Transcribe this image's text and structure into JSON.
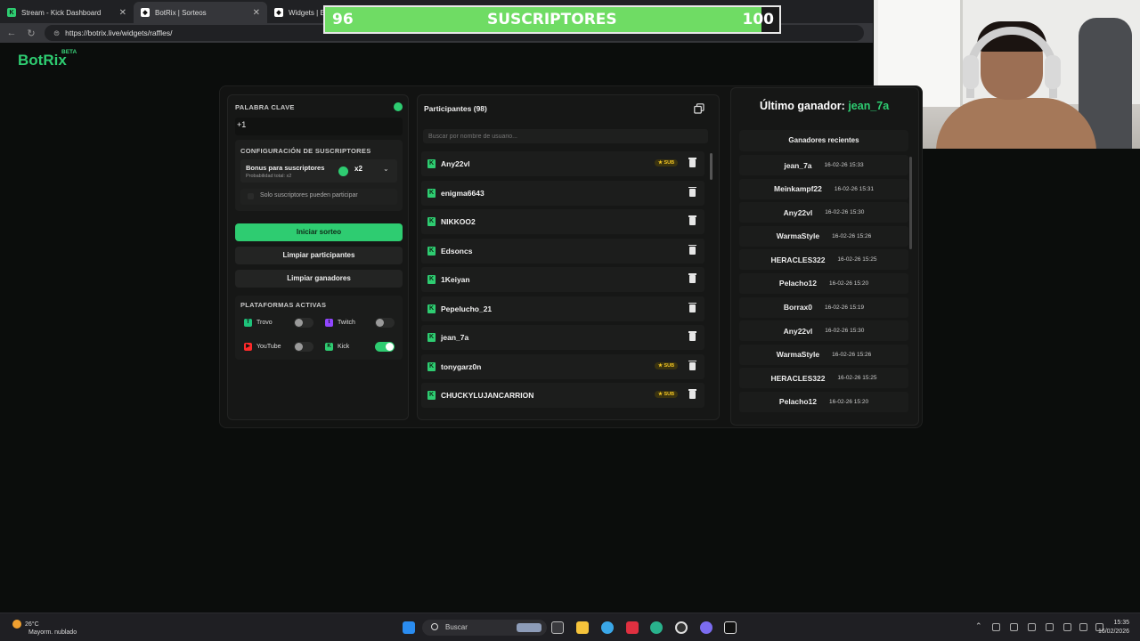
{
  "browser": {
    "tabs": [
      {
        "label": "Stream - Kick Dashboard",
        "active": false
      },
      {
        "label": "BotRix | Sorteos",
        "active": true
      },
      {
        "label": "Widgets | BotRix",
        "active": false
      }
    ],
    "url": "https://botrix.live/widgets/raffles/"
  },
  "overlay": {
    "sub_current": "96",
    "sub_label": "SUSCRIPTORES",
    "sub_goal": "100",
    "progress": 0.96
  },
  "app": {
    "logo": "BotRix",
    "beta": "BETA"
  },
  "left_panel": {
    "keyword_label": "PALABRA CLAVE",
    "keyword_value": "+1",
    "sub_config_label": "CONFIGURACIÓN DE SUSCRIPTORES",
    "bonus_title": "Bonus para suscriptores",
    "bonus_sub": "Probabilidad total: x2",
    "bonus_value": "x2",
    "only_subs_label": "Solo suscriptores pueden participar",
    "start_button": "Iniciar sorteo",
    "clear_participants_button": "Limpiar participantes",
    "clear_winners_button": "Limpiar ganadores",
    "platforms_label": "PLATAFORMAS ACTIVAS",
    "platforms": [
      {
        "name": "Trovo",
        "enabled": false,
        "color": "#1ec27a"
      },
      {
        "name": "Twitch",
        "enabled": false,
        "color": "#9146ff"
      },
      {
        "name": "YouTube",
        "enabled": false,
        "color": "#ff2a2a"
      },
      {
        "name": "Kick",
        "enabled": true,
        "color": "#2ecc71"
      }
    ]
  },
  "participants": {
    "title": "Participantes (98)",
    "search_placeholder": "Buscar por nombre de usuario...",
    "sub_badge": "★ SUB",
    "rows": [
      {
        "name": "Any22vl",
        "sub": true
      },
      {
        "name": "enigma6643",
        "sub": false
      },
      {
        "name": "NIKKOO2",
        "sub": false
      },
      {
        "name": "Edsoncs",
        "sub": false
      },
      {
        "name": "1Keiyan",
        "sub": false
      },
      {
        "name": "Pepelucho_21",
        "sub": false
      },
      {
        "name": "jean_7a",
        "sub": false
      },
      {
        "name": "tonygarz0n",
        "sub": true
      },
      {
        "name": "CHUCKYLUJANCARRION",
        "sub": true
      }
    ]
  },
  "winners": {
    "last_winner_label": "Último ganador:",
    "last_winner_name": "jean_7a",
    "recent_title": "Ganadores recientes",
    "rows": [
      {
        "name": "jean_7a",
        "date": "16-02-26 15:33"
      },
      {
        "name": "Meinkampf22",
        "date": "16-02-26 15:31"
      },
      {
        "name": "Any22vl",
        "date": "16-02-26 15:30"
      },
      {
        "name": "WarmaStyle",
        "date": "16-02-26 15:26"
      },
      {
        "name": "HERACLES322",
        "date": "16-02-26 15:25"
      },
      {
        "name": "Pelacho12",
        "date": "16-02-26 15:20"
      },
      {
        "name": "Borrax0",
        "date": "16-02-26 15:19"
      },
      {
        "name": "Any22vl",
        "date": "16-02-26 15:30"
      },
      {
        "name": "WarmaStyle",
        "date": "16-02-26 15:26"
      },
      {
        "name": "HERACLES322",
        "date": "16-02-26 15:25"
      },
      {
        "name": "Pelacho12",
        "date": "16-02-26 15:20"
      }
    ]
  },
  "taskbar": {
    "temp": "26°C",
    "weather": "Mayorm. nublado",
    "search": "Buscar",
    "time": "15:35",
    "date": "16/02/2026"
  },
  "colors": {
    "accent": "#2ecc71",
    "sub_badge": "#f3c623"
  }
}
